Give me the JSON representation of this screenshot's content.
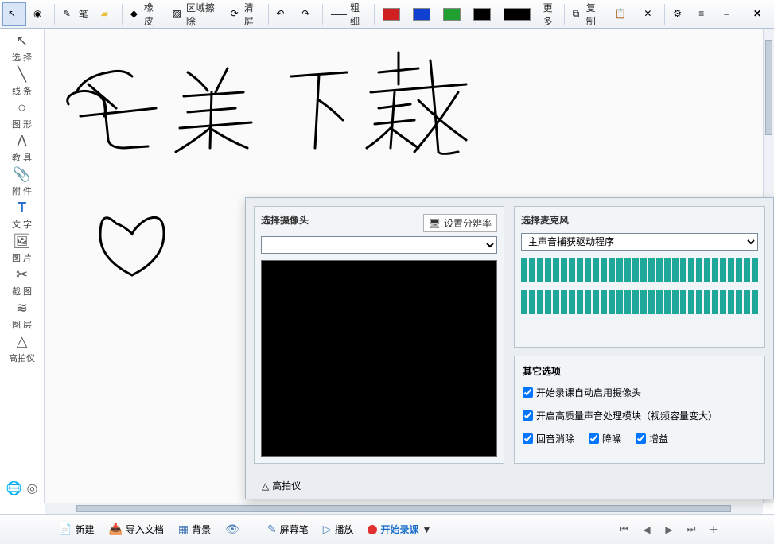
{
  "toolbar": {
    "pen": "笔",
    "highlighter": "",
    "eraser": "橡皮",
    "area_erase": "区域擦除",
    "clear": "清屏",
    "thickness": "粗细",
    "more": "更多",
    "copy": "复制",
    "colors": [
      "#d02020",
      "#1040d0",
      "#20a030",
      "#000000",
      "#000000"
    ]
  },
  "left_tools": [
    {
      "id": "select",
      "label": "选 择",
      "icon": "↖"
    },
    {
      "id": "line",
      "label": "线 条",
      "icon": "╲"
    },
    {
      "id": "shape",
      "label": "图 形",
      "icon": "○"
    },
    {
      "id": "teach",
      "label": "教 具",
      "icon": "Λ"
    },
    {
      "id": "attach",
      "label": "附 件",
      "icon": "📎"
    },
    {
      "id": "text",
      "label": "文 字",
      "icon": "T"
    },
    {
      "id": "image",
      "label": "图 片",
      "icon": "🖼"
    },
    {
      "id": "capture",
      "label": "截 图",
      "icon": "✂"
    },
    {
      "id": "layer",
      "label": "图 层",
      "icon": "≋"
    },
    {
      "id": "doccam",
      "label": "高拍仪",
      "icon": "△"
    }
  ],
  "bottom": {
    "new": "新建",
    "import": "导入文档",
    "background": "背景",
    "screenpen": "屏幕笔",
    "play": "播放",
    "record": "开始录课"
  },
  "dialog": {
    "camera_title": "选择摄像头",
    "set_resolution": "设置分辨率",
    "camera_selected": "",
    "mic_title": "选择麦克风",
    "mic_selected": "主声音捕获驱动程序",
    "options_title": "其它选项",
    "opt_auto_camera": "开始录课自动启用摄像头",
    "opt_hq_audio": "开启高质量声音处理模块（视频容量变大）",
    "opt_echo": "回音消除",
    "opt_noise": "降噪",
    "opt_gain": "增益",
    "doccam_tab": "高拍仪"
  }
}
